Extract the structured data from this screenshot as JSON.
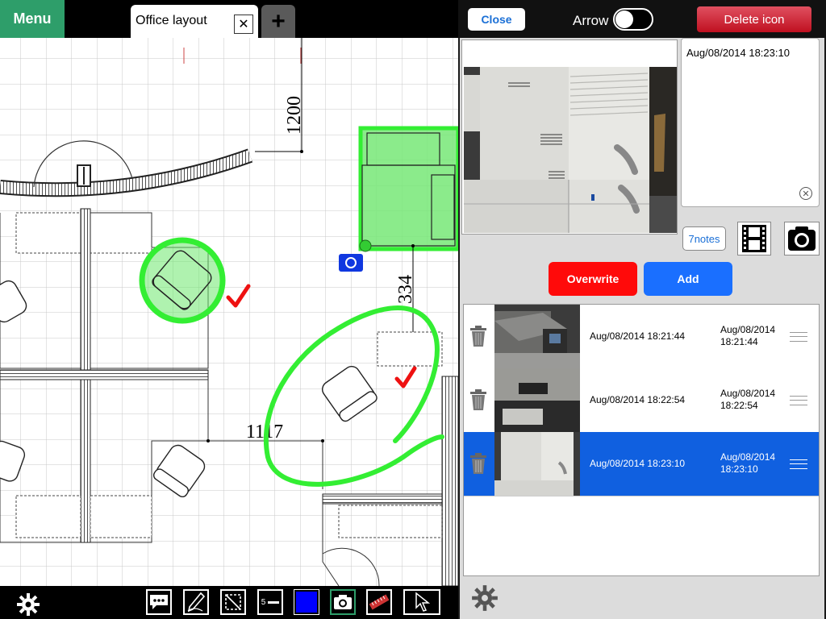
{
  "topbar": {
    "menu_label": "Menu",
    "tab_label": "Office layout",
    "tab_close": "✕",
    "tab_add": "+"
  },
  "plan": {
    "dimensions": [
      "1200",
      "334",
      "1117"
    ]
  },
  "toolbar": {
    "tools": [
      "settings",
      "comment",
      "pen",
      "rectangle",
      "line-width",
      "color",
      "camera",
      "ruler",
      "pointer"
    ],
    "line_width_value": "5",
    "color_swatch": "#0000ff"
  },
  "panel": {
    "close_label": "Close",
    "arrow_label": "Arrow",
    "arrow_on": false,
    "delete_label": "Delete icon",
    "note_text": "Aug/08/2014 18:23:10",
    "note_clear": "✕",
    "notes_label": "7notes",
    "overwrite_label": "Overwrite",
    "add_label": "Add",
    "rows": [
      {
        "date": "Aug/08/2014 18:21:44",
        "date2": "Aug/08/2014 18:21:44",
        "selected": false
      },
      {
        "date": "Aug/08/2014 18:22:54",
        "date2": "Aug/08/2014 18:22:54",
        "selected": false
      },
      {
        "date": "Aug/08/2014 18:23:10",
        "date2": "Aug/08/2014 18:23:10",
        "selected": true
      }
    ]
  },
  "colors": {
    "menu": "#2e9e6a",
    "highlight": "#33ee33",
    "check": "#ee1111",
    "selected_row": "#1060e0",
    "overwrite": "#ff0a0a",
    "add": "#1a6fff",
    "delete": "#c01020"
  }
}
